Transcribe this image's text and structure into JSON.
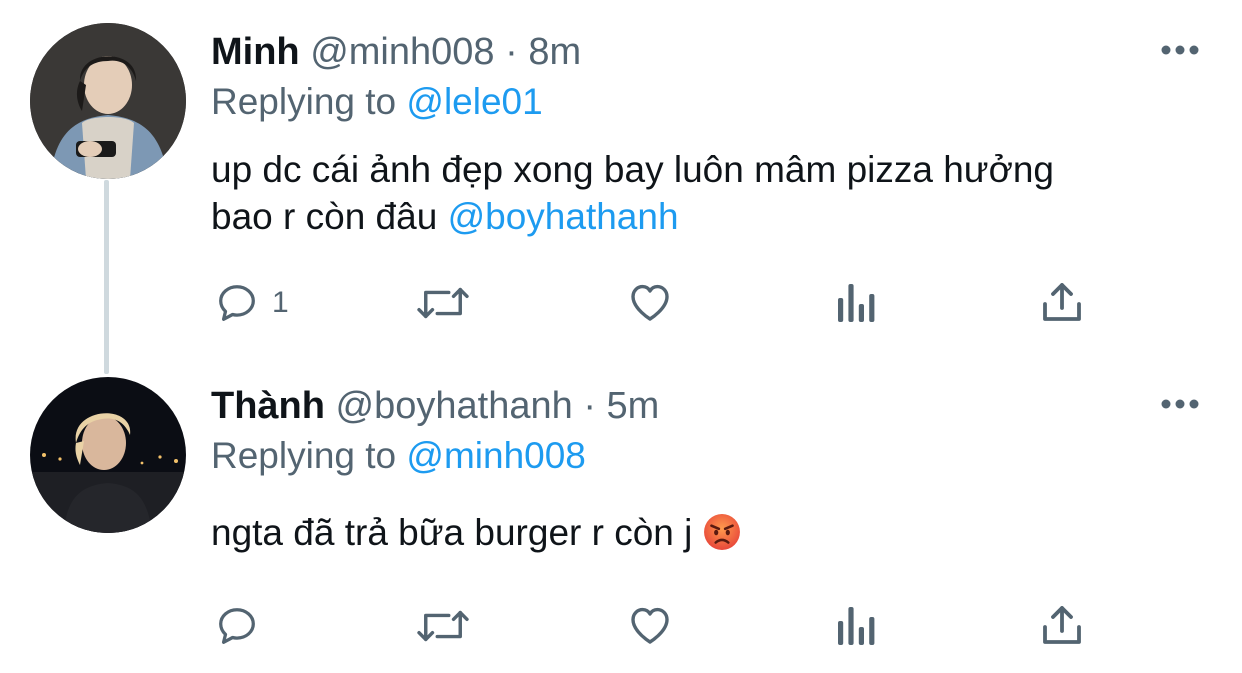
{
  "tweets": [
    {
      "name": "Minh",
      "handle": "@minh008",
      "time": "· 8m",
      "replying_prefix": "Replying to",
      "replying_to": "@lele01",
      "text_line1": "up dc cái ảnh đẹp xong bay luôn mâm pizza hưởng",
      "text_line2": "bao r còn đâu",
      "mention": "@boyhathanh",
      "reply_count": "1"
    },
    {
      "name": "Thành",
      "handle": "@boyhathanh",
      "time": "· 5m",
      "replying_prefix": "Replying to",
      "replying_to": "@minh008",
      "text": "ngta đã trả bữa burger r còn j",
      "emoji": "angry-face"
    }
  ],
  "colors": {
    "link": "#1d9bf0",
    "secondary_text": "#536471",
    "thread_line": "#cfd9de",
    "icon": "#536471"
  }
}
